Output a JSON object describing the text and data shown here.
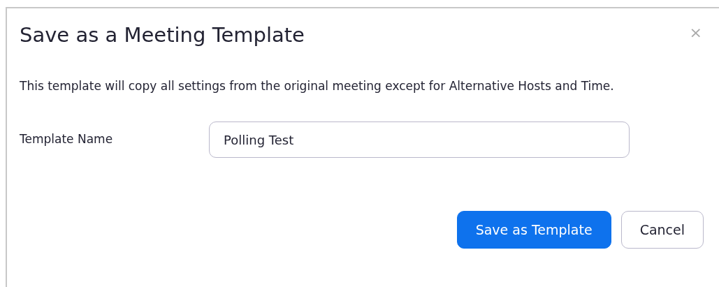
{
  "dialog": {
    "title": "Save as a Meeting Template",
    "close": "×",
    "description": "This template will copy all settings from the original meeting except for Alternative Hosts and Time.",
    "field": {
      "label": "Template Name",
      "value": "Polling Test"
    },
    "buttons": [
      {
        "label": "Save as Template",
        "kind": "primary"
      },
      {
        "label": "Cancel",
        "kind": "secondary"
      }
    ]
  }
}
